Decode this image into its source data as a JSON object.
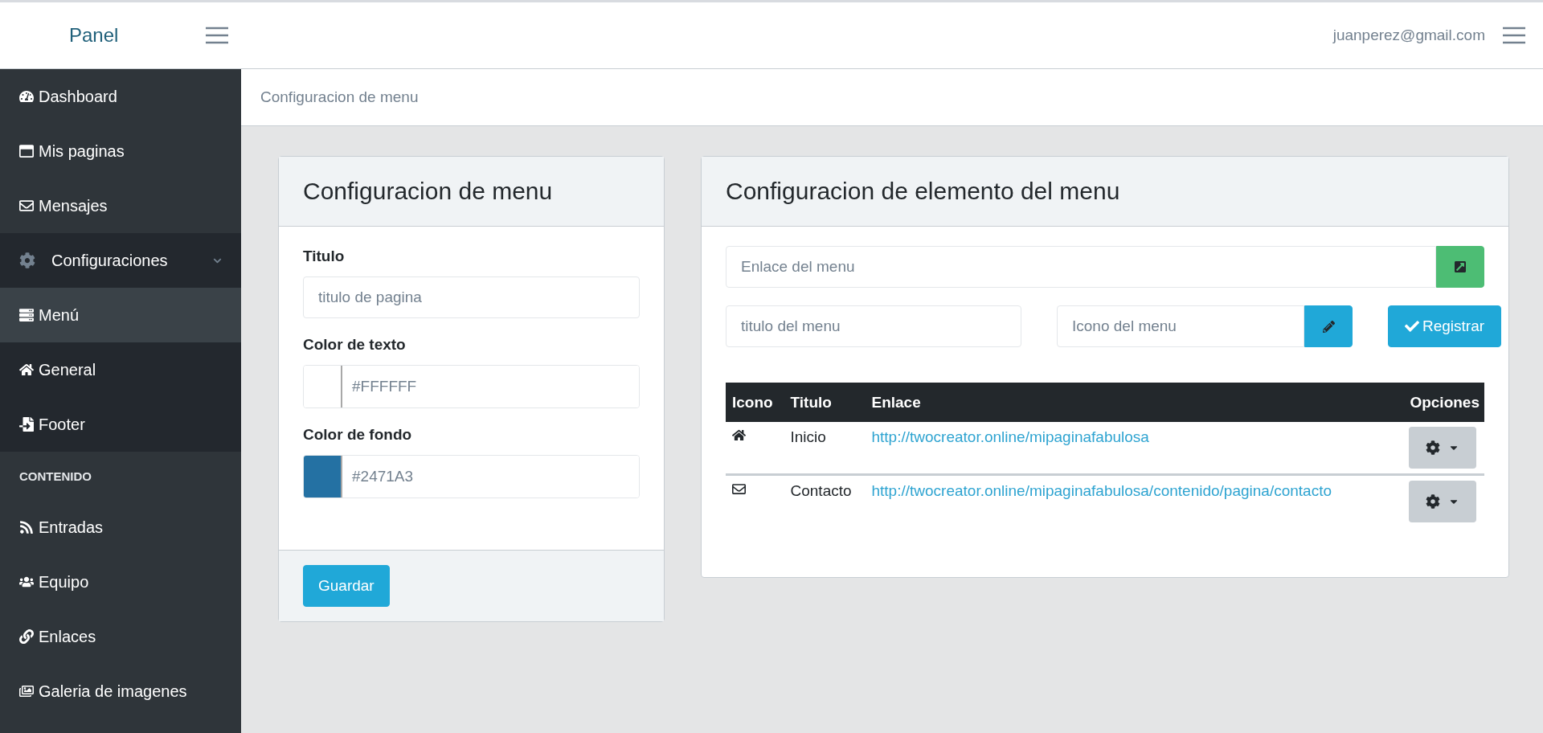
{
  "header": {
    "brand": "Panel",
    "user": "juanperez@gmail.com"
  },
  "sidebar": {
    "items": [
      {
        "kind": "link",
        "label": "Dashboard",
        "selected": false
      },
      {
        "kind": "link",
        "label": "Mis paginas",
        "selected": false
      },
      {
        "kind": "link",
        "label": "Mensajes",
        "selected": false
      },
      {
        "kind": "group",
        "label": "Configuraciones",
        "expanded": true,
        "children": [
          {
            "label": "Menú",
            "selected": true
          },
          {
            "label": "General",
            "selected": false
          },
          {
            "label": "Footer",
            "selected": false
          }
        ]
      },
      {
        "kind": "heading",
        "label": "CONTENIDO"
      },
      {
        "kind": "link",
        "label": "Entradas",
        "selected": false
      },
      {
        "kind": "link",
        "label": "Equipo",
        "selected": false
      },
      {
        "kind": "link",
        "label": "Enlaces",
        "selected": false
      },
      {
        "kind": "link",
        "label": "Galeria de imagenes",
        "selected": false
      }
    ]
  },
  "breadcrumb": "Configuracion de menu",
  "menu_card": {
    "title": "Configuracion de menu",
    "fields": [
      {
        "kind": "text",
        "label": "Titulo",
        "placeholder": "titulo de pagina"
      },
      {
        "kind": "color",
        "label": "Color de texto",
        "value": "#FFFFFF",
        "color": "#ffffff"
      },
      {
        "kind": "color",
        "label": "Color de fondo",
        "value": "#2471A3",
        "color": "#2471a3"
      }
    ],
    "button": "Guardar"
  },
  "item_card": {
    "title": "Configuracion de elemento del menu",
    "link_field": {
      "placeholder": "Enlace del menu"
    },
    "title_field": {
      "placeholder": "titulo del menu"
    },
    "icon_field": {
      "placeholder": "Icono del menu"
    },
    "register_button": "Registrar",
    "table": {
      "columns": [
        "Icono",
        "Titulo",
        "Enlace",
        "Opciones"
      ],
      "rows": [
        {
          "title": "Inicio",
          "link": "http://twocreator.online/mipaginafabulosa"
        },
        {
          "title": "Contacto",
          "link": "http://twocreator.online/mipaginafabulosa/contenido/pagina/contacto"
        }
      ]
    }
  }
}
